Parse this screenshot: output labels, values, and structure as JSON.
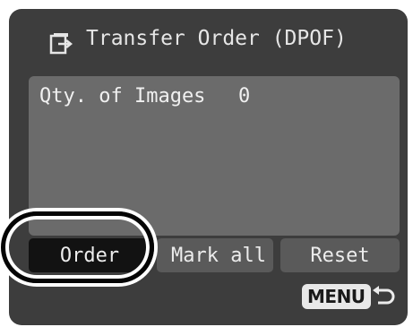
{
  "header": {
    "icon": "transfer-order-icon",
    "title": "Transfer Order (DPOF)"
  },
  "panel": {
    "qty_label": "Qty. of Images",
    "qty_value": "0"
  },
  "buttons": {
    "order": "Order",
    "mark_all": "Mark all",
    "reset": "Reset"
  },
  "footer": {
    "menu_label": "MENU",
    "back_icon": "back-arrow-icon"
  },
  "colors": {
    "screen_bg": "#3d3d3d",
    "panel_bg": "#6b6b6b",
    "selected_button": "#121212",
    "button_bg": "#5a5a5a",
    "text": "#ececec"
  }
}
